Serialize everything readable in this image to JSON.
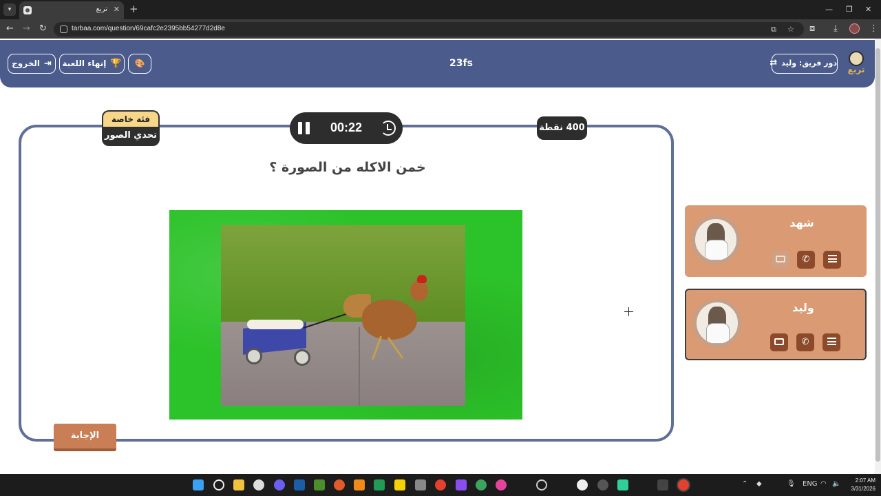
{
  "browser": {
    "tab_title": "تربع",
    "tab_close": "✕",
    "new_tab": "+",
    "url": "tarbaa.com/question/69cafc2e2395bb54277d2d8e",
    "window_controls": {
      "minimize": "—",
      "maximize": "❐",
      "close": "✕"
    }
  },
  "header": {
    "exit_label": "الخروج",
    "end_game_label": "إنهاء اللعبة",
    "game_name": "23fs",
    "turn_label": "دور فريق: وليد",
    "logo_text": "تربع"
  },
  "board": {
    "category_tag": "فئة خاصة",
    "category_name": "تحدي الصور",
    "timer": "00:22",
    "points": "400 نقطة",
    "question": "خمن الاكله من الصورة ؟",
    "answer_label": "الإجابة"
  },
  "teams": [
    {
      "name": "شهد",
      "active": false,
      "aids": [
        "list-icon",
        "phone-icon",
        "swap-icon"
      ],
      "swap_used": true
    },
    {
      "name": "وليد",
      "active": true,
      "aids": [
        "list-icon",
        "phone-icon",
        "swap-icon"
      ],
      "swap_used": false
    }
  ],
  "taskbar": {
    "lang": "ENG",
    "time": "2:07 AM",
    "date": "3/31/2026"
  },
  "colors": {
    "header": "#4a5b8c",
    "board_border": "#5f6f96",
    "team_card": "#d99a74",
    "aid_button": "#8c4a2b",
    "answer_button": "#c97e55",
    "category_tag": "#f7d689",
    "image_frame": "#2cc229"
  }
}
